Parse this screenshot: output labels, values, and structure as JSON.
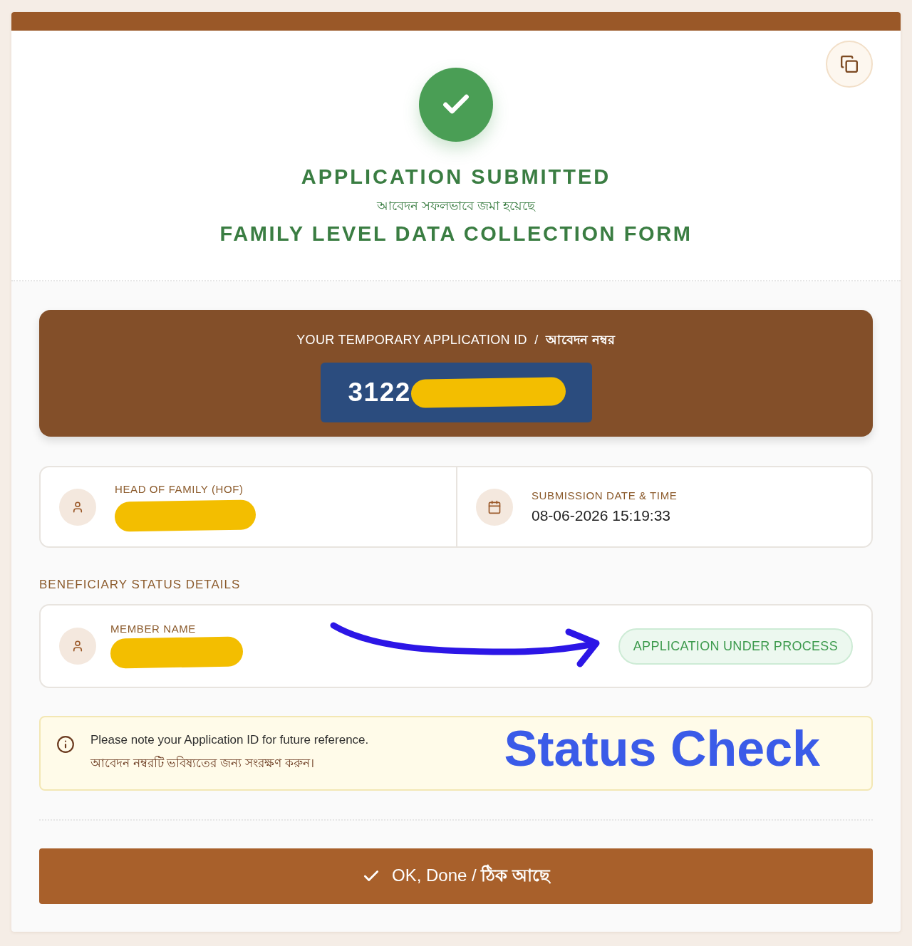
{
  "header": {
    "title": "APPLICATION SUBMITTED",
    "subtitle": "আবেদন সফলভাবে জমা হয়েছে",
    "form_name": "FAMILY LEVEL DATA COLLECTION FORM"
  },
  "application_id": {
    "label": "YOUR TEMPORARY APPLICATION ID  /  **আবেদন নম্বর**",
    "value": "3122",
    "redacted": true
  },
  "summary": [
    {
      "kind": "person",
      "label": "HEAD OF FAMILY (HOF)",
      "redacted": true
    },
    {
      "kind": "date",
      "label": "SUBMISSION DATE & TIME",
      "value": "08-06-2026 15:19:33"
    }
  ],
  "beneficiary_status": {
    "heading": "BENEFICIARY STATUS DETAILS",
    "members": [
      {
        "label": "MEMBER NAME",
        "redacted": true,
        "status": "APPLICATION UNDER PROCESS",
        "arrow_annotation": true
      }
    ]
  },
  "notice": {
    "lines": [
      "Please note your Application ID for future reference.",
      "আবেদন নম্বরটি ভবিষ্যতের জন্য সংরক্ষণ করুন।"
    ],
    "annotation": "Status Check"
  },
  "done_button": {
    "label": "OK, Done / **ঠিক আছে**"
  }
}
